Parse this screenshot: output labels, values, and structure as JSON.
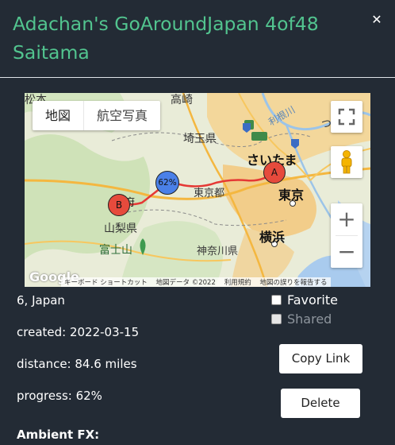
{
  "dialog": {
    "title": "Adachan's GoAroundJapan 4of48 Saitama",
    "close_glyph": "✕"
  },
  "map": {
    "map_type": {
      "map": "地図",
      "satellite": "航空写真"
    },
    "controls": {
      "zoom_in": "+",
      "zoom_out": "−"
    },
    "markers": {
      "a": "A",
      "b": "B",
      "progress": "62%"
    },
    "labels": {
      "matsumoto": "松本",
      "takasaki": "高崎",
      "tonegawa": "利根川",
      "tsuku": "つく",
      "saitama_pref": "埼玉県",
      "saitama_city": "さいたま",
      "tokyo_to": "東京都",
      "tokyo": "東京",
      "yamanashi": "山梨県",
      "fujisan": "富士山",
      "kanagawa": "神奈川県",
      "yokohama": "横浜",
      "kofu": "甲府"
    },
    "footer": {
      "shortcuts": "キーボード ショートカット",
      "data": "地図データ ©2022",
      "terms": "利用規約",
      "report": "地図の誤りを報告する"
    },
    "logo": "Google",
    "colors": {
      "route": "#e53935",
      "marker_red": "#e64a3c",
      "marker_blue": "#4a80e8"
    }
  },
  "details": {
    "location": "6, Japan",
    "created": "created: 2022-03-15",
    "distance": "distance: 84.6 miles",
    "progress": "progress: 62%",
    "ambient": "Ambient FX:"
  },
  "options": {
    "favorite": "Favorite",
    "shared": "Shared"
  },
  "actions": {
    "copy_link": "Copy Link",
    "delete": "Delete"
  },
  "theme": {
    "background": "#232b35",
    "title_color": "#52c48f"
  }
}
